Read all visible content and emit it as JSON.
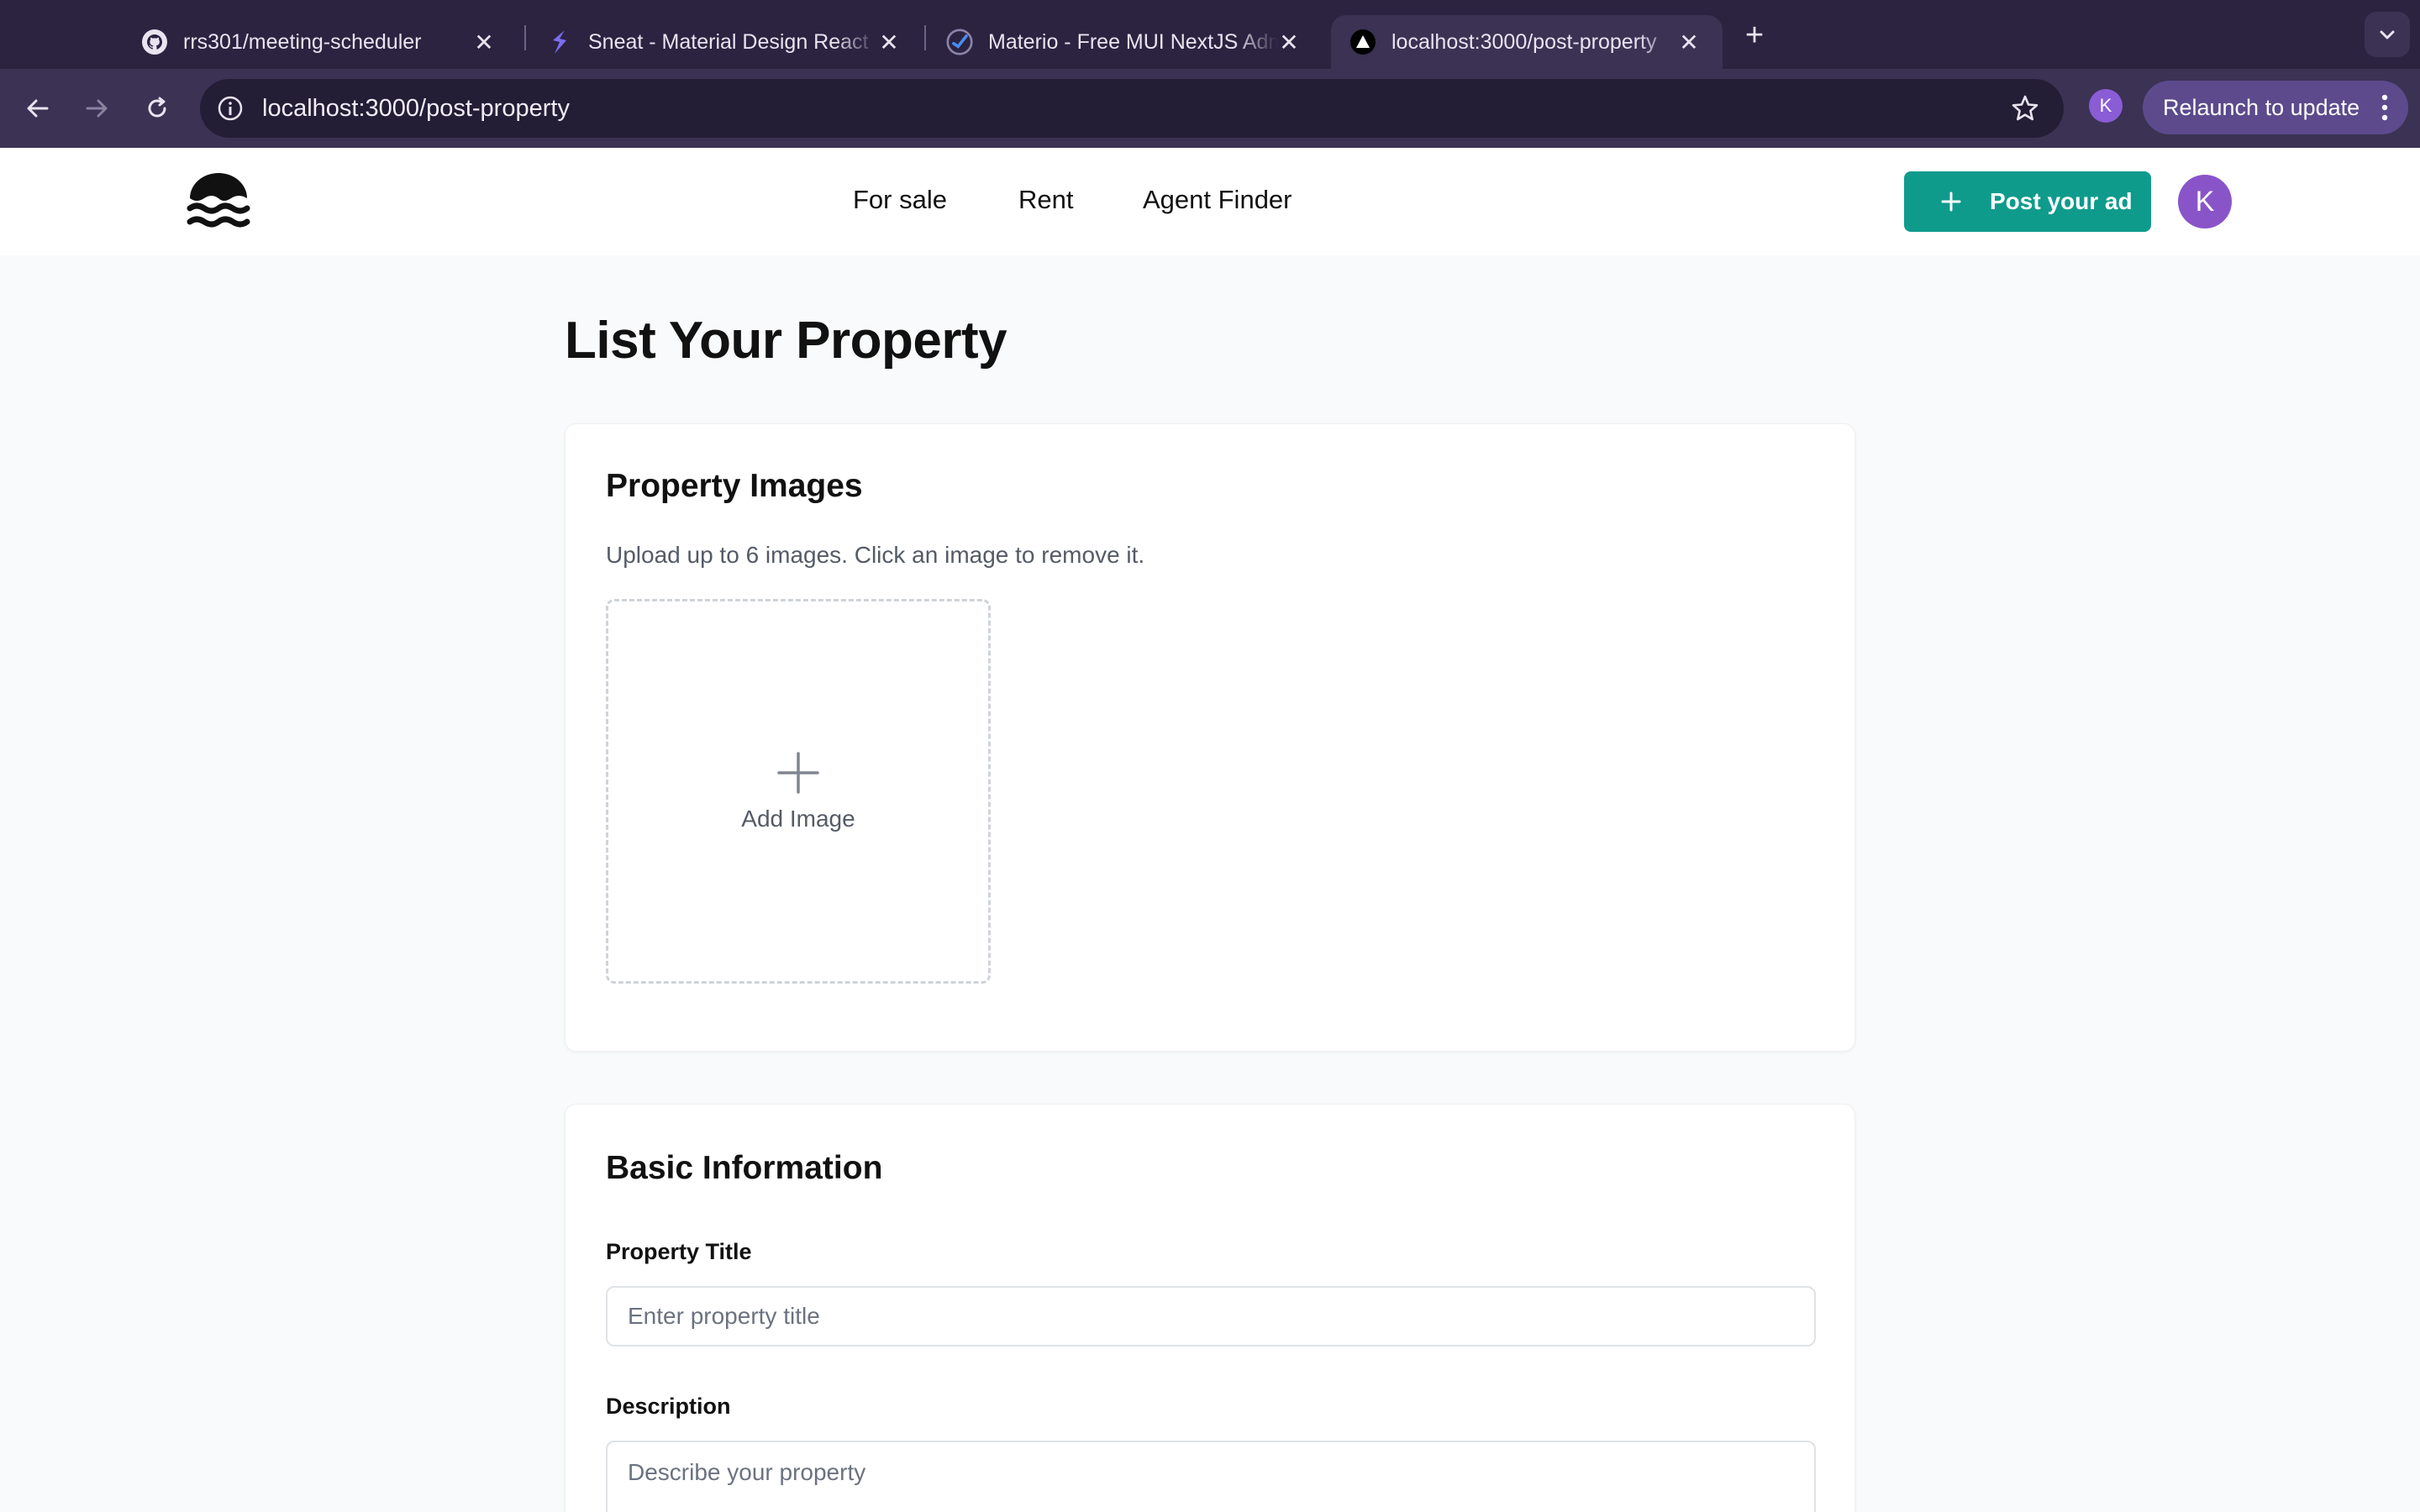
{
  "browser": {
    "tabs": [
      {
        "title": "rrs301/meeting-scheduler",
        "icon": "github-icon",
        "active": false
      },
      {
        "title": "Sneat - Material Design React",
        "icon": "sneat-logo-icon",
        "active": false
      },
      {
        "title": "Materio - Free MUI NextJS Admin",
        "icon": "materio-logo-icon",
        "active": false
      },
      {
        "title": "localhost:3000/post-property",
        "icon": "nextjs-triangle-icon",
        "active": true
      }
    ],
    "url": "localhost:3000/post-property",
    "profile_initial": "K",
    "relaunch_label": "Relaunch to update"
  },
  "header": {
    "nav": [
      "For sale",
      "Rent",
      "Agent Finder"
    ],
    "post_button_label": "Post your ad",
    "avatar_initial": "K",
    "accent_color": "#0f9b8c"
  },
  "page": {
    "title": "List Your Property"
  },
  "images_section": {
    "heading": "Property Images",
    "subtitle": "Upload up to 6 images. Click an image to remove it.",
    "add_label": "Add Image"
  },
  "basic_section": {
    "heading": "Basic Information",
    "title_label": "Property Title",
    "title_placeholder": "Enter property title",
    "title_value": "",
    "description_label": "Description",
    "description_placeholder": "Describe your property",
    "description_value": ""
  }
}
